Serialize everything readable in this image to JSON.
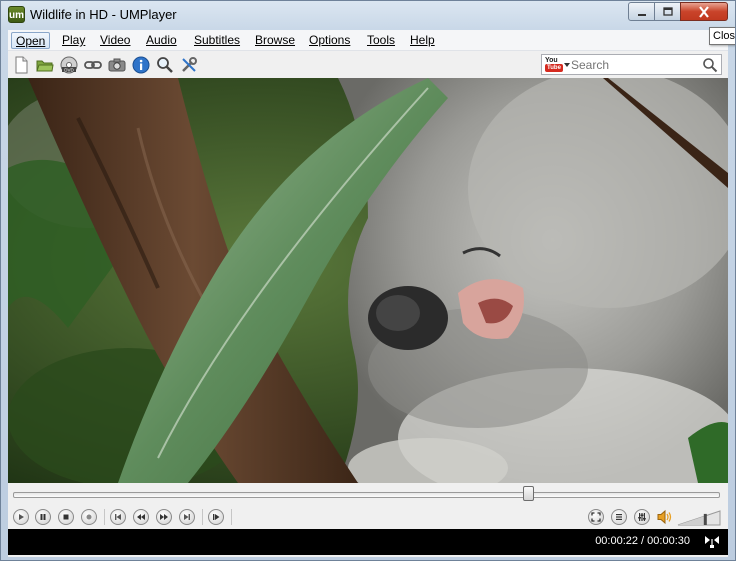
{
  "window": {
    "title": "Wildlife in HD - UMPlayer",
    "logo_text": "um",
    "close_tooltip": "Close"
  },
  "menu": {
    "items": [
      {
        "label": "Open",
        "active": true
      },
      {
        "label": "Play"
      },
      {
        "label": "Video"
      },
      {
        "label": "Audio"
      },
      {
        "label": "Subtitles"
      },
      {
        "label": "Browse"
      },
      {
        "label": "Options"
      },
      {
        "label": "Tools"
      },
      {
        "label": "Help"
      }
    ]
  },
  "toolbar": {
    "icons": [
      "new-file-icon",
      "open-folder-icon",
      "dvd-icon",
      "url-link-icon",
      "screenshot-camera-icon",
      "info-icon",
      "find-subtitles-icon",
      "tools-icon"
    ],
    "search": {
      "provider": "YouTube",
      "provider_top": "You",
      "provider_bottom": "Tube",
      "placeholder": "Search",
      "value": ""
    }
  },
  "playback": {
    "position_fraction": 0.7333,
    "current_time": "00:00:22",
    "total_time": "00:00:30",
    "time_display": "00:00:22 / 00:00:30"
  },
  "controls": {
    "left": [
      "play-icon",
      "pause-icon",
      "stop-icon",
      "frame-step-icon",
      "previous-icon",
      "rewind-icon",
      "forward-icon",
      "next-icon",
      "playlist-jump-icon"
    ],
    "right": [
      "fullscreen-icon",
      "playlist-icon",
      "equalizer-icon",
      "volume-icon"
    ],
    "volume_fraction": 0.65
  },
  "colors": {
    "title_bar": "#c8d7e7",
    "close_button": "#c9442a",
    "status_bar": "#000000"
  }
}
